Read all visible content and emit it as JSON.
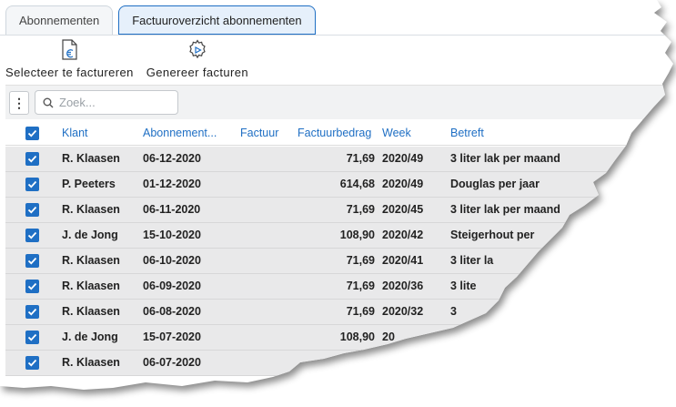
{
  "tabs": [
    {
      "label": "Abonnementen",
      "active": false
    },
    {
      "label": "Factuuroverzicht abonnementen",
      "active": true
    }
  ],
  "toolbar": {
    "select_label": "Selecteer te factureren",
    "generate_label": "Genereer facturen",
    "select_icon": "invoice-euro-icon",
    "generate_icon": "gear-play-icon"
  },
  "grid": {
    "menu_icon": "more-vertical-icon",
    "search_placeholder": "Zoek...",
    "search_value": "",
    "columns": [
      "Klant",
      "Abonnement...",
      "Factuur",
      "Factuurbedrag",
      "Week",
      "Betreft"
    ],
    "rows": [
      {
        "klant": "R. Klaasen",
        "abonnement": "06-12-2020",
        "factuur": "",
        "bedrag": "71,69",
        "week": "2020/49",
        "betreft": "3 liter lak per maand",
        "checked": true
      },
      {
        "klant": "P. Peeters",
        "abonnement": "01-12-2020",
        "factuur": "",
        "bedrag": "614,68",
        "week": "2020/49",
        "betreft": "Douglas per jaar",
        "checked": true
      },
      {
        "klant": "R. Klaasen",
        "abonnement": "06-11-2020",
        "factuur": "",
        "bedrag": "71,69",
        "week": "2020/45",
        "betreft": "3 liter lak per maand",
        "checked": true
      },
      {
        "klant": "J. de Jong",
        "abonnement": "15-10-2020",
        "factuur": "",
        "bedrag": "108,90",
        "week": "2020/42",
        "betreft": "Steigerhout per",
        "checked": true
      },
      {
        "klant": "R. Klaasen",
        "abonnement": "06-10-2020",
        "factuur": "",
        "bedrag": "71,69",
        "week": "2020/41",
        "betreft": "3 liter la",
        "checked": true
      },
      {
        "klant": "R. Klaasen",
        "abonnement": "06-09-2020",
        "factuur": "",
        "bedrag": "71,69",
        "week": "2020/36",
        "betreft": "3 lite",
        "checked": true
      },
      {
        "klant": "R. Klaasen",
        "abonnement": "06-08-2020",
        "factuur": "",
        "bedrag": "71,69",
        "week": "2020/32",
        "betreft": "3",
        "checked": true
      },
      {
        "klant": "J. de Jong",
        "abonnement": "15-07-2020",
        "factuur": "",
        "bedrag": "108,90",
        "week": "20",
        "betreft": "",
        "checked": true
      },
      {
        "klant": "R. Klaasen",
        "abonnement": "06-07-2020",
        "factuur": "",
        "bedrag": "",
        "week": "",
        "betreft": "",
        "checked": true
      }
    ]
  },
  "colors": {
    "accent": "#1f6fc4",
    "row_bg": "#e9e9ea"
  }
}
